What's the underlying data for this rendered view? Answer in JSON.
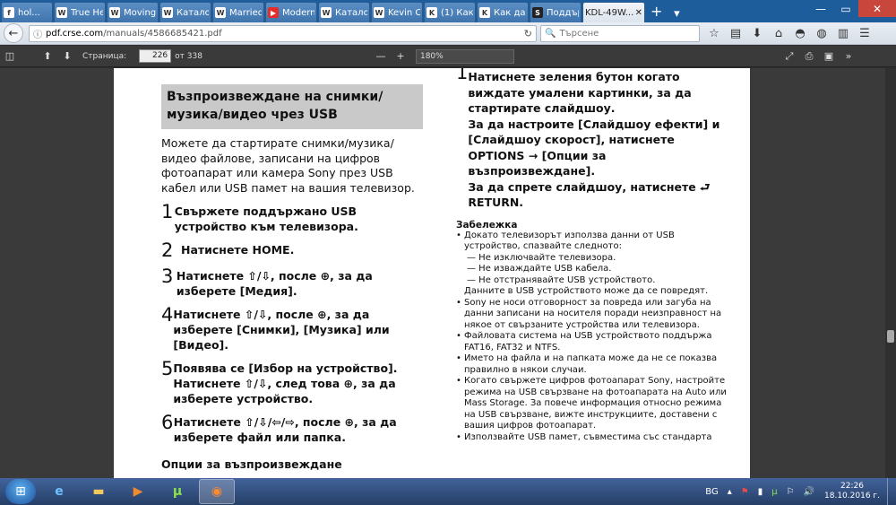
{
  "tabs": [
    {
      "label": "hol...",
      "icon": "facebook-icon"
    },
    {
      "label": "True Hea...",
      "icon": "wordpress-icon"
    },
    {
      "label": "Moving V...",
      "icon": "wordpress-icon"
    },
    {
      "label": "Каталог ...",
      "icon": "wordpress-icon"
    },
    {
      "label": "Married ...",
      "icon": "wordpress-icon"
    },
    {
      "label": "Modern ...",
      "icon": "youtube-icon"
    },
    {
      "label": "Каталог ...",
      "icon": "wordpress-icon"
    },
    {
      "label": "Kevin Ca...",
      "icon": "wordpress-icon"
    },
    {
      "label": "(1) Как да...",
      "icon": "k-icon"
    },
    {
      "label": "Как да гл...",
      "icon": "k-icon"
    },
    {
      "label": "Поддърж...",
      "icon": "s-icon"
    },
    {
      "label": "KDL-49W...",
      "icon": "page-icon",
      "active": true
    }
  ],
  "url": {
    "host": "pdf.crse.com",
    "path": "/manuals/4586685421.pdf"
  },
  "search_placeholder": "Търсене",
  "pdf": {
    "page_label": "Страница:",
    "page_value": "226",
    "page_total": "от 338",
    "zoom": "180%"
  },
  "doc": {
    "heading": "Възпроизвеждане на снимки/ музика/видео чрез USB",
    "intro": "Можете да стартирате снимки/музика/видео файлове, записани на цифров фотоапарат или камера Sony през USB кабел или USB памет на вашия телевизор.",
    "steps": [
      {
        "n": "1",
        "text": "Свържете поддържано USB устройство към телевизора."
      },
      {
        "n": "2",
        "text": "Натиснете HOME."
      },
      {
        "n": "3",
        "text": "Натиснете ⇧/⇩, после ⊕, за да изберете [Медия]."
      },
      {
        "n": "4",
        "text": "Натиснете ⇧/⇩, после ⊕, за да изберете [Снимки], [Музика] или [Видео]."
      },
      {
        "n": "5",
        "text": "Появява се [Избор на устройство]. Натиснете ⇧/⇩, след това ⊕, за да изберете устройство."
      },
      {
        "n": "6",
        "text": "Натиснете ⇧/⇩/⇦/⇨, после ⊕, за да изберете файл или папка."
      }
    ],
    "cut_text": "Опции за възпроизвеждане",
    "right_step_num": "1",
    "right_step_lines": [
      "Натиснете зеления бутон когато виждате умалени картинки, за да стартирате слайдшоу.",
      "За да настроите [Слайдшоу ефекти] и [Слайдшоу скорост], натиснете OPTIONS → [Опции за възпроизвеждане].",
      "За да спрете слайдшоу, натиснете ⮐ RETURN."
    ],
    "note_title": "Забележка",
    "notes": [
      "Докато телевизорът използва данни от USB устройство, спазвайте следното:",
      "— Не изключвайте телевизора.",
      "— Не изваждайте USB кабела.",
      "— Не отстранявайте USB устройството.",
      "Данните в USB устройството може да се повредят.",
      "Sony не носи отговорност за повреда или загуба на данни записани на носителя поради неизправност на някое от свързаните устройства или телевизора.",
      "Файловата система на USB устройството поддържа FAT16, FAT32 и NTFS.",
      "Името на файла и на папката може да не се показва правилно в някои случаи.",
      "Когато свържете цифров фотоапарат Sony, настройте режима на USB свързване на фотоапарата на Auto или Mass Storage. За повече информация относно режима на USB свързване, вижте инструкциите, доставени с вашия цифров фотоапарат.",
      "Използвайте USB памет, съвместима със стандарта"
    ]
  },
  "tray": {
    "lang": "BG",
    "time": "22:26",
    "date": "18.10.2016 г."
  }
}
